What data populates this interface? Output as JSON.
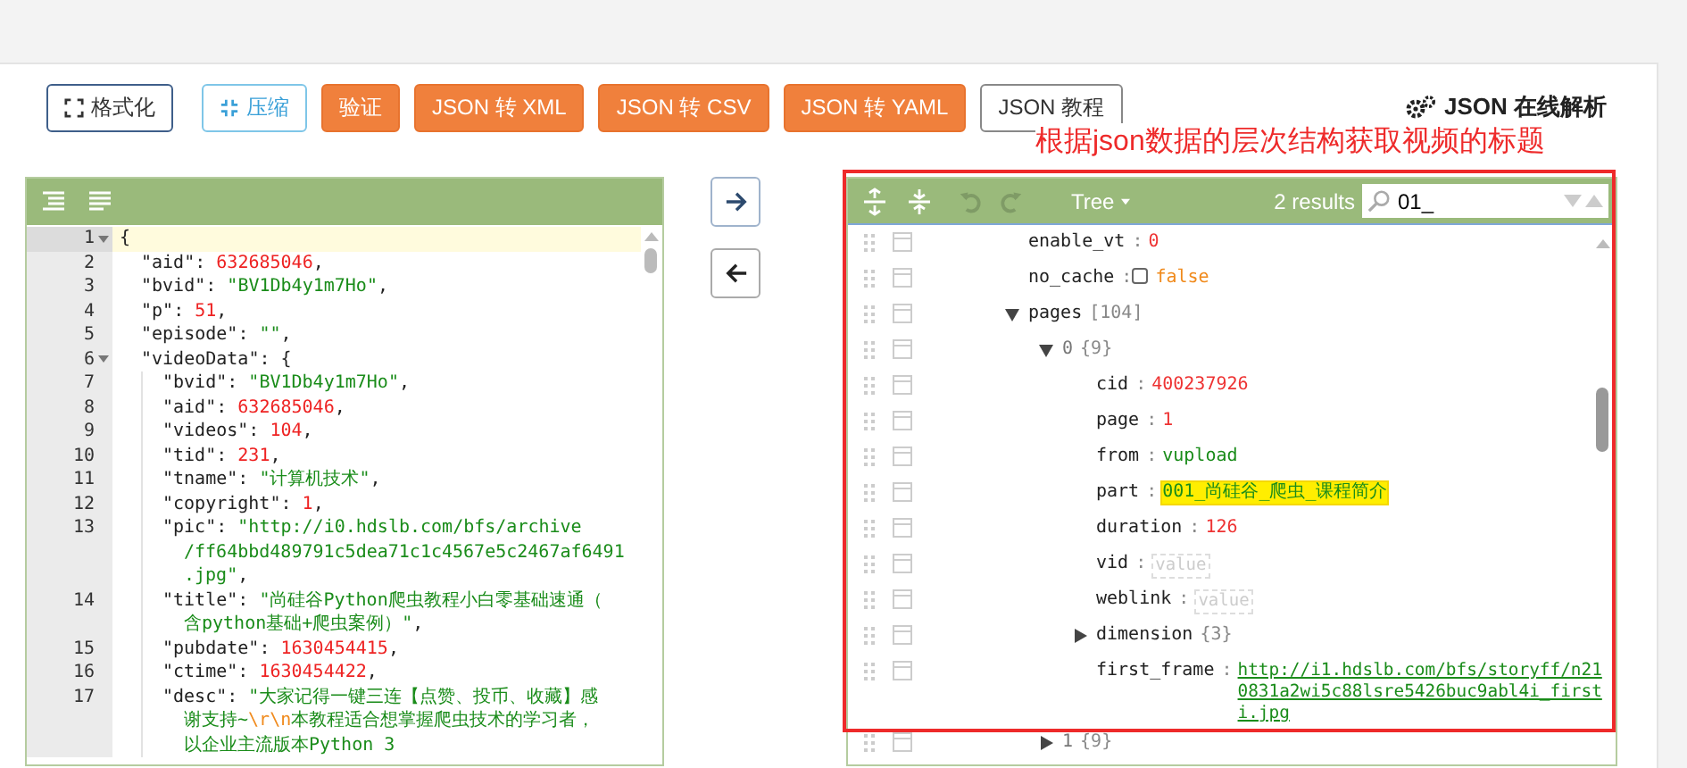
{
  "toolbar": {
    "buttons": [
      {
        "label": "格式化",
        "kind": "format"
      },
      {
        "label": "压缩",
        "kind": "compress"
      },
      {
        "label": "验证",
        "kind": "action"
      },
      {
        "label": "JSON 转 XML",
        "kind": "action"
      },
      {
        "label": "JSON 转 CSV",
        "kind": "action"
      },
      {
        "label": "JSON 转 YAML",
        "kind": "action"
      },
      {
        "label": "JSON 教程",
        "kind": "plain"
      }
    ],
    "title": "JSON 在线解析"
  },
  "annotation": "根据json数据的层次结构获取视频的标题",
  "editor": {
    "lines": [
      {
        "number": "1",
        "fold": true,
        "active": true,
        "tokens": [
          {
            "kind": "punct",
            "text": "{"
          }
        ],
        "children": [
          {
            "number": "2",
            "fold": false,
            "active": false,
            "tokens": [
              {
                "kind": "key",
                "text": "\"aid\""
              },
              {
                "kind": "colon",
                "text": ":"
              },
              {
                "kind": "num",
                "text": "632685046"
              },
              {
                "kind": "punct",
                "text": ","
              }
            ]
          },
          {
            "number": "3",
            "fold": false,
            "active": false,
            "tokens": [
              {
                "kind": "key",
                "text": "\"bvid\""
              },
              {
                "kind": "colon",
                "text": ":"
              },
              {
                "kind": "str",
                "text": "\"BV1Db4y1m7Ho\""
              },
              {
                "kind": "punct",
                "text": ","
              }
            ]
          },
          {
            "number": "4",
            "fold": false,
            "active": false,
            "tokens": [
              {
                "kind": "key",
                "text": "\"p\""
              },
              {
                "kind": "colon",
                "text": ":"
              },
              {
                "kind": "num",
                "text": "51"
              },
              {
                "kind": "punct",
                "text": ","
              }
            ]
          },
          {
            "number": "5",
            "fold": false,
            "active": false,
            "tokens": [
              {
                "kind": "key",
                "text": "\"episode\""
              },
              {
                "kind": "colon",
                "text": ":"
              },
              {
                "kind": "str",
                "text": "\"\""
              },
              {
                "kind": "punct",
                "text": ","
              }
            ]
          },
          {
            "number": "6",
            "fold": true,
            "active": false,
            "tokens": [
              {
                "kind": "key",
                "text": "\"videoData\""
              },
              {
                "kind": "colon",
                "text": ":"
              },
              {
                "kind": "punct",
                "text": "{"
              }
            ],
            "children": [
              {
                "number": "7",
                "fold": false,
                "active": false,
                "tokens": [
                  {
                    "kind": "key",
                    "text": "\"bvid\""
                  },
                  {
                    "kind": "colon",
                    "text": ":"
                  },
                  {
                    "kind": "str",
                    "text": "\"BV1Db4y1m7Ho\""
                  },
                  {
                    "kind": "punct",
                    "text": ","
                  }
                ]
              },
              {
                "number": "8",
                "fold": false,
                "active": false,
                "tokens": [
                  {
                    "kind": "key",
                    "text": "\"aid\""
                  },
                  {
                    "kind": "colon",
                    "text": ":"
                  },
                  {
                    "kind": "num",
                    "text": "632685046"
                  },
                  {
                    "kind": "punct",
                    "text": ","
                  }
                ]
              },
              {
                "number": "9",
                "fold": false,
                "active": false,
                "tokens": [
                  {
                    "kind": "key",
                    "text": "\"videos\""
                  },
                  {
                    "kind": "colon",
                    "text": ":"
                  },
                  {
                    "kind": "num",
                    "text": "104"
                  },
                  {
                    "kind": "punct",
                    "text": ","
                  }
                ]
              },
              {
                "number": "10",
                "fold": false,
                "active": false,
                "tokens": [
                  {
                    "kind": "key",
                    "text": "\"tid\""
                  },
                  {
                    "kind": "colon",
                    "text": ":"
                  },
                  {
                    "kind": "num",
                    "text": "231"
                  },
                  {
                    "kind": "punct",
                    "text": ","
                  }
                ]
              },
              {
                "number": "11",
                "fold": false,
                "active": false,
                "tokens": [
                  {
                    "kind": "key",
                    "text": "\"tname\""
                  },
                  {
                    "kind": "colon",
                    "text": ":"
                  },
                  {
                    "kind": "str",
                    "text": "\"计算机技术\""
                  },
                  {
                    "kind": "punct",
                    "text": ","
                  }
                ]
              },
              {
                "number": "12",
                "fold": false,
                "active": false,
                "tokens": [
                  {
                    "kind": "key",
                    "text": "\"copyright\""
                  },
                  {
                    "kind": "colon",
                    "text": ":"
                  },
                  {
                    "kind": "num",
                    "text": "1"
                  },
                  {
                    "kind": "punct",
                    "text": ","
                  }
                ]
              },
              {
                "number": "13",
                "fold": false,
                "active": false,
                "tokens": [
                  {
                    "kind": "key",
                    "text": "\"pic\""
                  },
                  {
                    "kind": "colon",
                    "text": ":"
                  },
                  {
                    "kind": "str",
                    "text": "\"http://i0.hdslb.com/bfs/archive"
                  }
                ],
                "wrap": [
                  [
                    {
                      "kind": "str",
                      "text": "/ff64bbd489791c5dea71c1c4567e5c2467af6491"
                    }
                  ],
                  [
                    {
                      "kind": "str",
                      "text": ".jpg\""
                    },
                    {
                      "kind": "punct",
                      "text": ","
                    }
                  ]
                ]
              },
              {
                "number": "14",
                "fold": false,
                "active": false,
                "tokens": [
                  {
                    "kind": "key",
                    "text": "\"title\""
                  },
                  {
                    "kind": "colon",
                    "text": ":"
                  },
                  {
                    "kind": "str",
                    "text": "\"尚硅谷Python爬虫教程小白零基础速通（"
                  }
                ],
                "wrap": [
                  [
                    {
                      "kind": "str",
                      "text": "含python基础+爬虫案例）\""
                    },
                    {
                      "kind": "punct",
                      "text": ","
                    }
                  ]
                ]
              },
              {
                "number": "15",
                "fold": false,
                "active": false,
                "tokens": [
                  {
                    "kind": "key",
                    "text": "\"pubdate\""
                  },
                  {
                    "kind": "colon",
                    "text": ":"
                  },
                  {
                    "kind": "num",
                    "text": "1630454415"
                  },
                  {
                    "kind": "punct",
                    "text": ","
                  }
                ]
              },
              {
                "number": "16",
                "fold": false,
                "active": false,
                "tokens": [
                  {
                    "kind": "key",
                    "text": "\"ctime\""
                  },
                  {
                    "kind": "colon",
                    "text": ":"
                  },
                  {
                    "kind": "num",
                    "text": "1630454422"
                  },
                  {
                    "kind": "punct",
                    "text": ","
                  }
                ]
              },
              {
                "number": "17",
                "fold": false,
                "active": false,
                "tokens": [
                  {
                    "kind": "key",
                    "text": "\"desc\""
                  },
                  {
                    "kind": "colon",
                    "text": ":"
                  },
                  {
                    "kind": "str",
                    "text": "\"大家记得一键三连【点赞、投币、收藏】感"
                  }
                ],
                "wrap": [
                  [
                    {
                      "kind": "str",
                      "text": "谢支持~"
                    },
                    {
                      "kind": "esc",
                      "text": "\\r\\n"
                    },
                    {
                      "kind": "str",
                      "text": "本教程适合想掌握爬虫技术的学习者，"
                    }
                  ],
                  [
                    {
                      "kind": "str",
                      "text": "以企业主流版本Python 3"
                    }
                  ]
                ]
              }
            ]
          }
        ]
      }
    ]
  },
  "transfer_buttons": [
    {
      "kind": "right"
    },
    {
      "kind": "left"
    }
  ],
  "tree": {
    "mode": "Tree",
    "results": "2 results",
    "search": {
      "value": "01_"
    },
    "rows": [
      {
        "key": "enable_vt",
        "sep": ":",
        "kind": "number",
        "value": "0",
        "highlighted": false
      },
      {
        "key": "no_cache",
        "sep": ":",
        "kind": "boolean",
        "value": "false",
        "checked": false,
        "highlighted": false
      },
      {
        "key": "pages",
        "kind": "array",
        "count": "[104]",
        "expanded": true,
        "children": [
          {
            "key": "0",
            "kind": "object",
            "count": "{9}",
            "expanded": true,
            "children": [
              {
                "key": "cid",
                "sep": ":",
                "kind": "number",
                "value": "400237926",
                "highlighted": false
              },
              {
                "key": "page",
                "sep": ":",
                "kind": "number",
                "value": "1",
                "highlighted": false
              },
              {
                "key": "from",
                "sep": ":",
                "kind": "string",
                "value": "vupload",
                "highlighted": false
              },
              {
                "key": "part",
                "sep": ":",
                "kind": "string",
                "value": "001_尚硅谷_爬虫_课程简介",
                "highlighted": true
              },
              {
                "key": "duration",
                "sep": ":",
                "kind": "number",
                "value": "126",
                "highlighted": false
              },
              {
                "key": "vid",
                "sep": ":",
                "kind": "empty",
                "placeholder": "value"
              },
              {
                "key": "weblink",
                "sep": ":",
                "kind": "empty",
                "placeholder": "value"
              },
              {
                "key": "dimension",
                "kind": "object",
                "count": "{3}",
                "expanded": false
              },
              {
                "key": "first_frame",
                "sep": ":",
                "kind": "link",
                "value": "http://i1.hdslb.com/bfs/storyff/n210831a2wi5c88lsre5426buc9abl4i_firsti.jpg",
                "highlighted": false
              }
            ]
          },
          {
            "key": "1",
            "kind": "object",
            "count": "{9}",
            "expanded": false
          }
        ]
      }
    ]
  }
}
